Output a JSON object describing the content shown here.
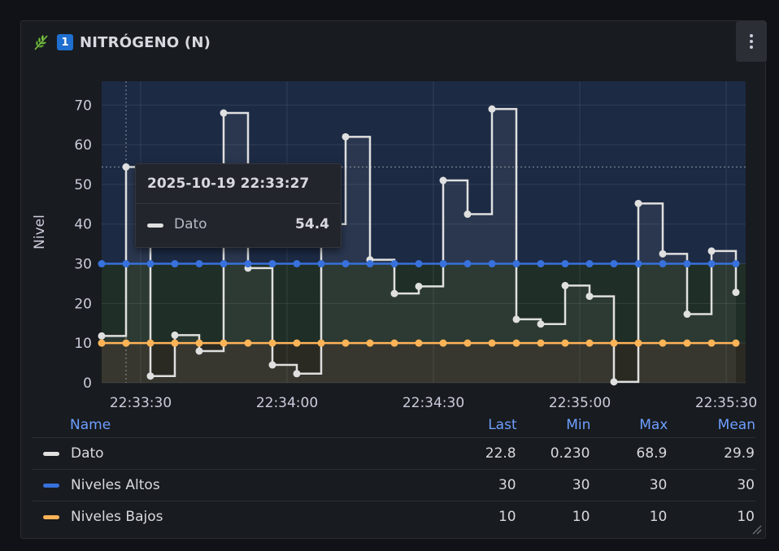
{
  "panel": {
    "title": "NITRÓGENO (N)",
    "title_icons": [
      "leaf-icon",
      "keycap-1-icon"
    ],
    "keycap_number": "1",
    "menu_icon": "vertical-ellipsis-icon"
  },
  "colors": {
    "background": "#111217",
    "panel": "#181b1f",
    "dato": "#e0e0e0",
    "altos": "#3871dc",
    "bajos": "#ffb357",
    "zone_high": "#1c2a44",
    "zone_mid": "#1f2e26",
    "zone_low": "#2b2a22",
    "accent_header": "#6e9fff"
  },
  "chart_data": {
    "type": "line",
    "interpolation": "step-after",
    "ylabel": "Nivel",
    "xlabel": "",
    "ylim": [
      0,
      76
    ],
    "yticks": [
      "0",
      "10",
      "20",
      "30",
      "40",
      "50",
      "60",
      "70"
    ],
    "xticks": [
      "22:33:30",
      "22:34:00",
      "22:34:30",
      "22:35:00",
      "22:35:30"
    ],
    "xlim_seconds_after_22_33_00": [
      22,
      154
    ],
    "grid": true,
    "threshold_zones": [
      {
        "from": 30,
        "to": 76,
        "color": "blue"
      },
      {
        "from": 10,
        "to": 30,
        "color": "green"
      },
      {
        "from": 0,
        "to": 10,
        "color": "yellow"
      }
    ],
    "x": [
      "22:33:22",
      "22:33:27",
      "22:33:32",
      "22:33:37",
      "22:33:42",
      "22:33:47",
      "22:33:52",
      "22:33:57",
      "22:34:02",
      "22:34:07",
      "22:34:12",
      "22:34:17",
      "22:34:22",
      "22:34:27",
      "22:34:32",
      "22:34:37",
      "22:34:42",
      "22:34:47",
      "22:34:52",
      "22:34:57",
      "22:35:02",
      "22:35:07",
      "22:35:12",
      "22:35:17",
      "22:35:22",
      "22:35:27",
      "22:35:32"
    ],
    "series": [
      {
        "name": "Dato",
        "values": [
          11.8,
          54.4,
          1.7,
          12.0,
          8.0,
          68.0,
          28.9,
          4.5,
          2.3,
          40.0,
          62.0,
          31.0,
          22.5,
          24.3,
          51.0,
          42.5,
          69.0,
          16.0,
          14.8,
          24.5,
          21.8,
          0.23,
          45.2,
          32.5,
          17.3,
          33.2,
          22.8
        ]
      },
      {
        "name": "Niveles Altos",
        "values": [
          30,
          30,
          30,
          30,
          30,
          30,
          30,
          30,
          30,
          30,
          30,
          30,
          30,
          30,
          30,
          30,
          30,
          30,
          30,
          30,
          30,
          30,
          30,
          30,
          30,
          30,
          30
        ]
      },
      {
        "name": "Niveles Bajos",
        "values": [
          10,
          10,
          10,
          10,
          10,
          10,
          10,
          10,
          10,
          10,
          10,
          10,
          10,
          10,
          10,
          10,
          10,
          10,
          10,
          10,
          10,
          10,
          10,
          10,
          10,
          10,
          10
        ]
      }
    ]
  },
  "tooltip": {
    "time": "2025-10-19 22:33:27",
    "series": "Dato",
    "value": "54.4"
  },
  "legend": {
    "headers": {
      "name": "Name",
      "last": "Last",
      "min": "Min",
      "max": "Max",
      "mean": "Mean"
    },
    "rows": [
      {
        "name": "Dato",
        "last": "22.8",
        "min": "0.230",
        "max": "68.9",
        "mean": "29.9",
        "color": "#e0e0e0"
      },
      {
        "name": "Niveles Altos",
        "last": "30",
        "min": "30",
        "max": "30",
        "mean": "30",
        "color": "#3871dc"
      },
      {
        "name": "Niveles Bajos",
        "last": "10",
        "min": "10",
        "max": "10",
        "mean": "10",
        "color": "#ffb357"
      }
    ]
  }
}
